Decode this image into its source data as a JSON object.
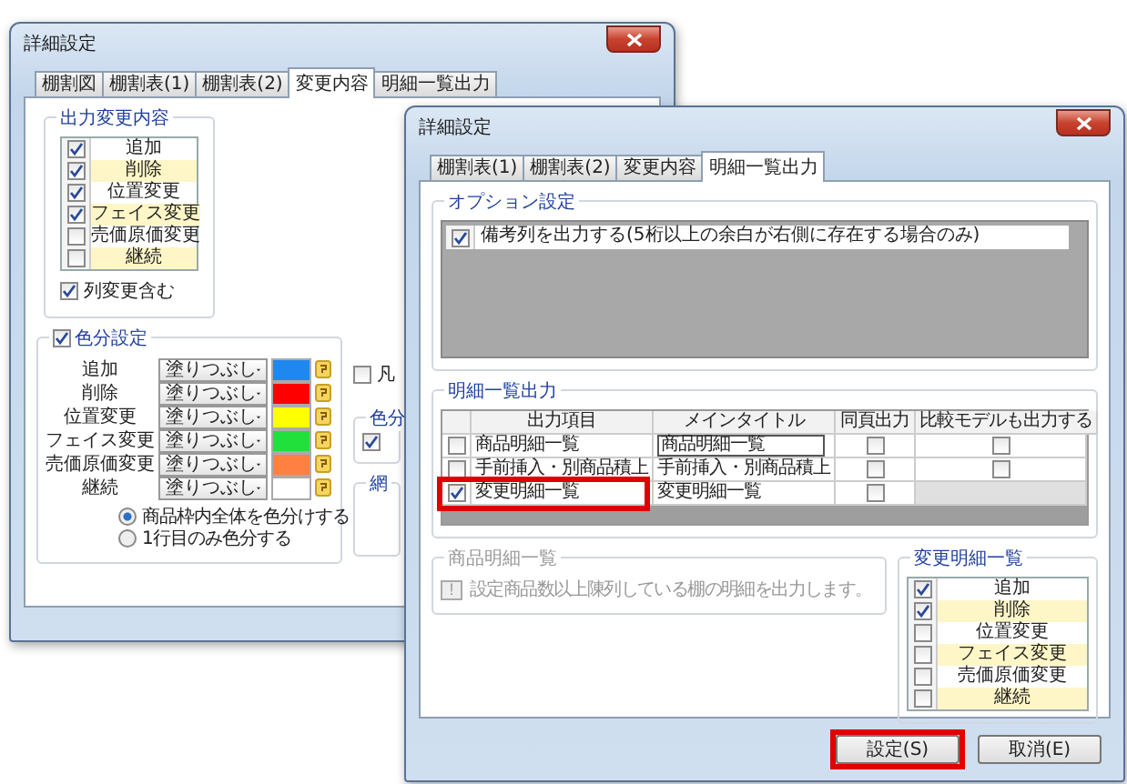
{
  "back_window": {
    "title": "詳細設定",
    "tabs": [
      {
        "label": "棚割図",
        "selected": false
      },
      {
        "label": "棚割表(1)",
        "selected": false
      },
      {
        "label": "棚割表(2)",
        "selected": false
      },
      {
        "label": "変更内容",
        "selected": true
      },
      {
        "label": "明細一覧出力",
        "selected": false
      }
    ],
    "output_changes": {
      "title": "出力変更内容",
      "items": [
        {
          "label": "追加",
          "checked": true
        },
        {
          "label": "削除",
          "checked": true
        },
        {
          "label": "位置変更",
          "checked": true
        },
        {
          "label": "フェイス変更",
          "checked": true
        },
        {
          "label": "売価原価変更",
          "checked": false
        },
        {
          "label": "継続",
          "checked": false
        }
      ],
      "include_column_changes": {
        "label": "列変更含む",
        "checked": true
      }
    },
    "color_settings": {
      "label": "色分設定",
      "checked": true,
      "rows": [
        {
          "label": "追加",
          "fill": "塗りつぶし",
          "color": "#1e88f0"
        },
        {
          "label": "削除",
          "fill": "塗りつぶし",
          "color": "#ff0000"
        },
        {
          "label": "位置変更",
          "fill": "塗りつぶし",
          "color": "#ffff00"
        },
        {
          "label": "フェイス変更",
          "fill": "塗りつぶし",
          "color": "#22e03c"
        },
        {
          "label": "売価原価変更",
          "fill": "塗りつぶし",
          "color": "#ff8040"
        },
        {
          "label": "継続",
          "fill": "塗りつぶし",
          "color": "#ffffff"
        }
      ],
      "modes": [
        {
          "label": "商品枠内全体を色分けする",
          "selected": true
        },
        {
          "label": "1行目のみ色分する",
          "selected": false
        }
      ]
    },
    "side": {
      "legend": {
        "label": "凡",
        "checked": false
      },
      "color_group": {
        "title": "色分",
        "checked": true
      },
      "group_title": "網"
    }
  },
  "front_window": {
    "title": "詳細設定",
    "tabs": [
      {
        "label": "棚割表(1)",
        "selected": false
      },
      {
        "label": "棚割表(2)",
        "selected": false
      },
      {
        "label": "変更内容",
        "selected": false
      },
      {
        "label": "明細一覧出力",
        "selected": true
      }
    ],
    "options": {
      "title": "オプション設定",
      "items": [
        {
          "label": "備考列を出力する(5桁以上の余白が右側に存在する場合のみ)",
          "checked": true
        }
      ]
    },
    "detail_output": {
      "title": "明細一覧出力",
      "columns": [
        "出力項目",
        "メインタイトル",
        "同頁出力",
        "比較モデルも出力する"
      ],
      "rows": [
        {
          "checked": false,
          "item": "商品明細一覧",
          "main_title": "商品明細一覧",
          "editing": true,
          "same_page": false,
          "compare": {
            "checked": false
          },
          "highlighted": false
        },
        {
          "checked": false,
          "item": "手前挿入・別商品積上",
          "main_title": "手前挿入・別商品積上",
          "editing": false,
          "same_page": false,
          "compare": {
            "checked": false
          },
          "highlighted": false
        },
        {
          "checked": true,
          "item": "変更明細一覧",
          "main_title": "変更明細一覧",
          "editing": false,
          "same_page": false,
          "highlighted": true
        }
      ]
    },
    "product_detail": {
      "title": "商品明細一覧",
      "disabled": true,
      "button": "!",
      "text": "設定商品数以上陳列している棚の明細を出力します。"
    },
    "change_detail": {
      "title": "変更明細一覧",
      "items": [
        {
          "label": "追加",
          "checked": true
        },
        {
          "label": "削除",
          "checked": true
        },
        {
          "label": "位置変更",
          "checked": false
        },
        {
          "label": "フェイス変更",
          "checked": false
        },
        {
          "label": "売価原価変更",
          "checked": false
        },
        {
          "label": "継続",
          "checked": false
        }
      ]
    },
    "buttons": [
      {
        "label": "設定(S)",
        "highlighted": true
      },
      {
        "label": "取消(E)",
        "highlighted": false
      }
    ]
  }
}
